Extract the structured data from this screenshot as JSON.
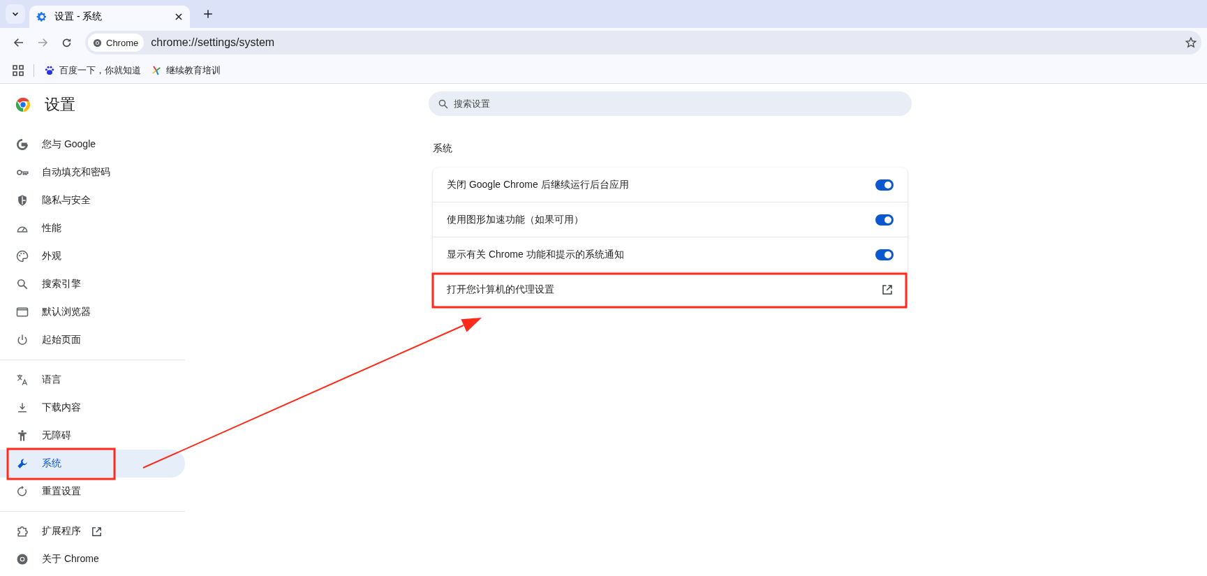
{
  "browser": {
    "tabs": [
      {
        "title": "设置 - 系统",
        "selected": true
      }
    ],
    "address_bar": {
      "chip": "Chrome",
      "url": "chrome://settings/system"
    },
    "bookmarks": [
      {
        "label": "百度一下，你就知道"
      },
      {
        "label": "继续教育培训"
      }
    ]
  },
  "settings": {
    "title": "设置",
    "search": {
      "placeholder": "搜索设置"
    },
    "sidebar": {
      "groups": [
        [
          {
            "label": "您与 Google",
            "selected": false,
            "external": false
          },
          {
            "label": "自动填充和密码",
            "selected": false,
            "external": false
          },
          {
            "label": "隐私与安全",
            "selected": false,
            "external": false
          },
          {
            "label": "性能",
            "selected": false,
            "external": false
          },
          {
            "label": "外观",
            "selected": false,
            "external": false
          },
          {
            "label": "搜索引擎",
            "selected": false,
            "external": false
          },
          {
            "label": "默认浏览器",
            "selected": false,
            "external": false
          },
          {
            "label": "起始页面",
            "selected": false,
            "external": false
          }
        ],
        [
          {
            "label": "语言",
            "selected": false,
            "external": false
          },
          {
            "label": "下载内容",
            "selected": false,
            "external": false
          },
          {
            "label": "无障碍",
            "selected": false,
            "external": false
          },
          {
            "label": "系统",
            "selected": true,
            "external": false
          },
          {
            "label": "重置设置",
            "selected": false,
            "external": false
          }
        ],
        [
          {
            "label": "扩展程序",
            "selected": false,
            "external": true
          },
          {
            "label": "关于 Chrome",
            "selected": false,
            "external": false
          }
        ]
      ]
    },
    "section_title": "系统",
    "rows": [
      {
        "kind": "toggle",
        "label": "关闭 Google Chrome 后继续运行后台应用",
        "on": true
      },
      {
        "kind": "toggle",
        "label": "使用图形加速功能（如果可用）",
        "on": true
      },
      {
        "kind": "toggle",
        "label": "显示有关 Chrome 功能和提示的系统通知",
        "on": true
      },
      {
        "kind": "link",
        "label": "打开您计算机的代理设置"
      }
    ]
  }
}
